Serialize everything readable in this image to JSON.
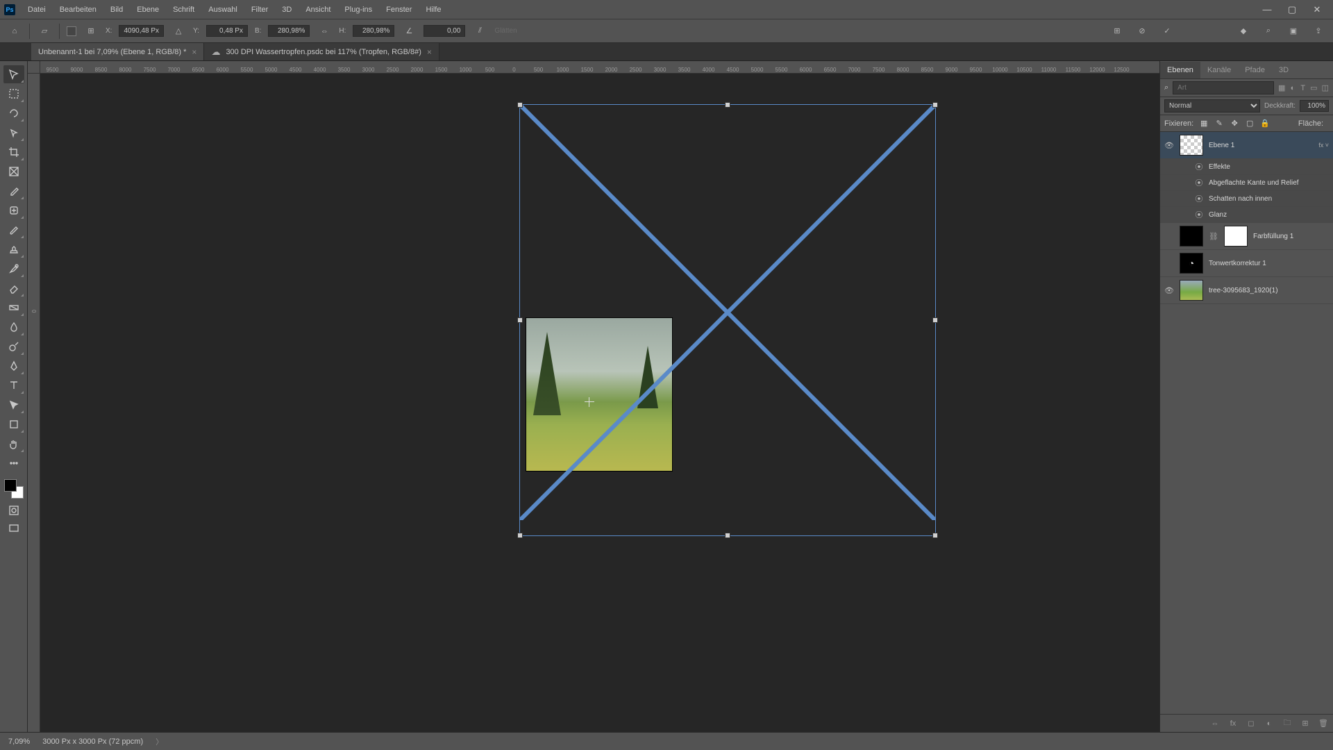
{
  "menu": {
    "items": [
      "Datei",
      "Bearbeiten",
      "Bild",
      "Ebene",
      "Schrift",
      "Auswahl",
      "Filter",
      "3D",
      "Ansicht",
      "Plug-ins",
      "Fenster",
      "Hilfe"
    ]
  },
  "optbar": {
    "x_label": "X:",
    "x_value": "4090,48 Px",
    "y_label": "Y:",
    "y_value": "0,48 Px",
    "w_label": "B:",
    "w_value": "280,98%",
    "h_label": "H:",
    "h_value": "280,98%",
    "rot_label": "",
    "rot_value": "0,00",
    "interp_label": "Glätten"
  },
  "tabs": [
    {
      "title": "Unbenannt-1 bei 7,09% (Ebene 1, RGB/8) *",
      "active": true
    },
    {
      "title": "300 DPI Wassertropfen.psdc bei 117% (Tropfen, RGB/8#)",
      "active": false
    }
  ],
  "ruler": {
    "ticks": [
      "9500",
      "9000",
      "8500",
      "8000",
      "7500",
      "7000",
      "6500",
      "6000",
      "5500",
      "5000",
      "4500",
      "4000",
      "3500",
      "3000",
      "2500",
      "2000",
      "1500",
      "1000",
      "500",
      "0",
      "500",
      "1000",
      "1500",
      "2000",
      "2500",
      "3000",
      "3500",
      "4000",
      "4500",
      "5000",
      "5500",
      "6000",
      "6500",
      "7000",
      "7500",
      "8000",
      "8500",
      "9000",
      "9500",
      "10000",
      "10500",
      "11000",
      "11500",
      "12000",
      "12500"
    ]
  },
  "ruler_v": {
    "zero": "0"
  },
  "panels": {
    "tabs": [
      "Ebenen",
      "Kanäle",
      "Pfade",
      "3D"
    ],
    "search_placeholder": "Art",
    "blend_mode": "Normal",
    "opacity_label": "Deckkraft:",
    "opacity_value": "100%",
    "lock_label": "Fixieren:",
    "fill_label": "Fläche:",
    "fill_value": ""
  },
  "layers": [
    {
      "name": "Ebene 1",
      "visible": true,
      "selected": true,
      "thumb": "checker",
      "fx": true,
      "effects_label": "Effekte",
      "effects": [
        "Abgeflachte Kante und Relief",
        "Schatten nach innen",
        "Glanz"
      ]
    },
    {
      "name": "Farbfüllung 1",
      "visible": false,
      "thumb": "black",
      "mask": "white"
    },
    {
      "name": "Tonwertkorrektur 1",
      "visible": false,
      "thumb": "adj"
    },
    {
      "name": "tree-3095683_1920(1)",
      "visible": true,
      "thumb": "img"
    }
  ],
  "status": {
    "zoom": "7,09%",
    "doc_info": "3000 Px x 3000 Px (72 ppcm)"
  }
}
